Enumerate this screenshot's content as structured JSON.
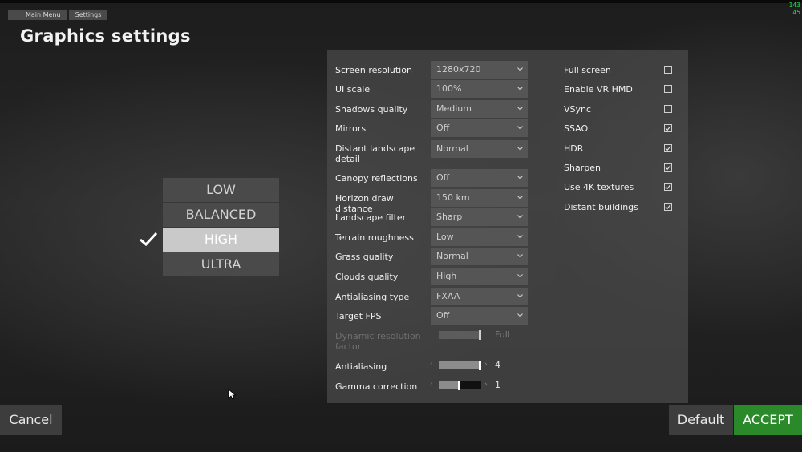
{
  "breadcrumb": [
    "Main Menu",
    "Settings"
  ],
  "title": "Graphics settings",
  "fps_counter": {
    "line1": "143",
    "line2": "45",
    "color": "#19e34a"
  },
  "presets": {
    "items": [
      "LOW",
      "BALANCED",
      "HIGH",
      "ULTRA"
    ],
    "selected": "HIGH"
  },
  "settings": {
    "screen_resolution": {
      "label": "Screen resolution",
      "value": "1280x720"
    },
    "ui_scale": {
      "label": "UI scale",
      "value": "100%"
    },
    "shadows_quality": {
      "label": "Shadows quality",
      "value": "Medium"
    },
    "mirrors": {
      "label": "Mirrors",
      "value": "Off"
    },
    "distant_landscape_detail": {
      "label": "Distant landscape detail",
      "value": "Normal"
    },
    "canopy_reflections": {
      "label": "Canopy reflections",
      "value": "Off"
    },
    "horizon_draw_distance": {
      "label": "Horizon draw distance",
      "value": "150 km"
    },
    "landscape_filter": {
      "label": "Landscape filter",
      "value": "Sharp"
    },
    "terrain_roughness": {
      "label": "Terrain roughness",
      "value": "Low"
    },
    "grass_quality": {
      "label": "Grass quality",
      "value": "Normal"
    },
    "clouds_quality": {
      "label": "Clouds quality",
      "value": "High"
    },
    "antialiasing_type": {
      "label": "Antialiasing type",
      "value": "FXAA"
    },
    "target_fps": {
      "label": "Target FPS",
      "value": "Off"
    },
    "dynamic_resolution_factor": {
      "label": "Dynamic resolution factor",
      "value": "Full",
      "level": 1.0,
      "enabled": false
    },
    "antialiasing": {
      "label": "Antialiasing",
      "value": "4",
      "level": 1.0
    },
    "gamma_correction": {
      "label": "Gamma correction",
      "value": "1",
      "level": 0.5
    }
  },
  "toggles": {
    "full_screen": {
      "label": "Full screen",
      "checked": false
    },
    "enable_vr_hmd": {
      "label": "Enable VR HMD",
      "checked": false
    },
    "vsync": {
      "label": "VSync",
      "checked": false
    },
    "ssao": {
      "label": "SSAO",
      "checked": true
    },
    "hdr": {
      "label": "HDR",
      "checked": true
    },
    "sharpen": {
      "label": "Sharpen",
      "checked": true
    },
    "use_4k_textures": {
      "label": "Use 4K textures",
      "checked": true
    },
    "distant_buildings": {
      "label": "Distant buildings",
      "checked": true
    }
  },
  "buttons": {
    "cancel": "Cancel",
    "default": "Default",
    "accept": "ACCEPT"
  },
  "colors": {
    "accent_green": "#2a8a2a",
    "panel": "#4b4b4b",
    "preset_selected": "#c9c9c9"
  },
  "icons": {
    "checkmark": "check-icon",
    "dropdown": "chevron-down-icon",
    "cursor": "mouse-pointer-icon"
  }
}
